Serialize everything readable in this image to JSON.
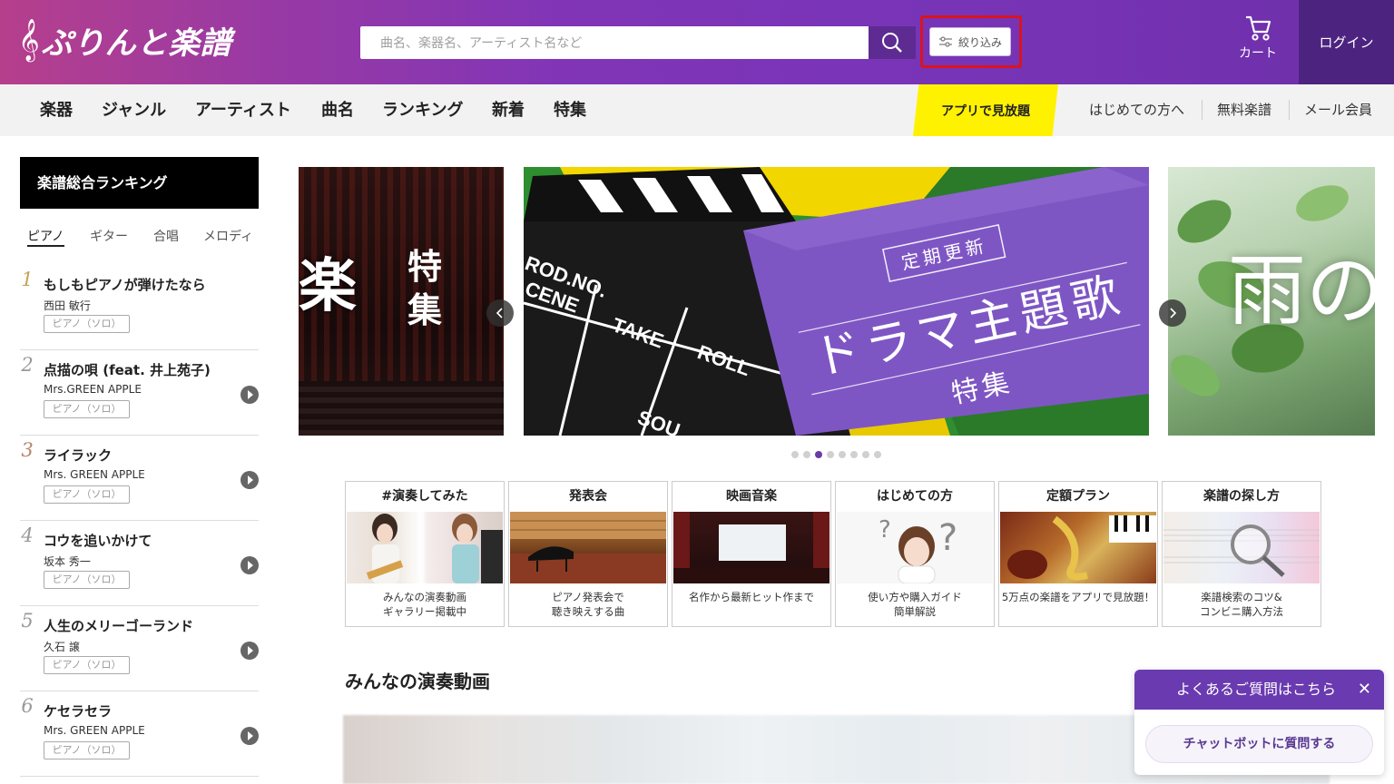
{
  "header": {
    "logo_text": "ぷりんと楽譜",
    "search_placeholder": "曲名、楽器名、アーティスト名など",
    "filter_label": "絞り込み",
    "cart_label": "カート",
    "login_label": "ログイン"
  },
  "nav": {
    "items": [
      "楽器",
      "ジャンル",
      "アーティスト",
      "曲名",
      "ランキング",
      "新着",
      "特集"
    ],
    "app_label": "アプリで見放題",
    "sub_items": [
      "はじめての方へ",
      "無料楽譜",
      "メール会員"
    ]
  },
  "ranking": {
    "title": "楽譜総合ランキング",
    "tabs": [
      "ピアノ",
      "ギター",
      "合唱",
      "メロディ"
    ],
    "active_tab": "ピアノ",
    "items": [
      {
        "rank": "1",
        "title": "もしもピアノが弾けたなら",
        "artist": "西田 敏行",
        "tag": "ピアノ（ソロ）"
      },
      {
        "rank": "2",
        "title": "点描の唄 (feat. 井上苑子)",
        "artist": "Mrs.GREEN APPLE",
        "tag": "ピアノ（ソロ）"
      },
      {
        "rank": "3",
        "title": "ライラック",
        "artist": "Mrs. GREEN APPLE",
        "tag": "ピアノ（ソロ）"
      },
      {
        "rank": "4",
        "title": "コウを追いかけて",
        "artist": "坂本 秀一",
        "tag": "ピアノ（ソロ）"
      },
      {
        "rank": "5",
        "title": "人生のメリーゴーランド",
        "artist": "久石 譲",
        "tag": "ピアノ（ソロ）"
      },
      {
        "rank": "6",
        "title": "ケセラセラ",
        "artist": "Mrs. GREEN APPLE",
        "tag": "ピアノ（ソロ）"
      }
    ]
  },
  "carousel": {
    "left_text_big": "楽",
    "left_text_small": "特集",
    "main": {
      "badge": "定期更新",
      "title": "ドラマ主題歌",
      "subtitle": "特集",
      "clapper_words": [
        "ROD.NO.",
        "CENE",
        "TAKE",
        "ROLL",
        "SOU"
      ]
    },
    "right_text": "雨の",
    "dot_count": 8,
    "active_dot": 3
  },
  "cards": [
    {
      "title": "#演奏してみた",
      "desc1": "みんなの演奏動画",
      "desc2": "ギャラリー掲載中"
    },
    {
      "title": "発表会",
      "desc1": "ピアノ発表会で",
      "desc2": "聴き映えする曲"
    },
    {
      "title": "映画音楽",
      "desc1": "名作から最新ヒット作まで",
      "desc2": ""
    },
    {
      "title": "はじめての方",
      "desc1": "使い方や購入ガイド",
      "desc2": "簡単解説"
    },
    {
      "title": "定額プラン",
      "desc1": "5万点の楽譜をアプリで見放題！",
      "desc2": ""
    },
    {
      "title": "楽譜の探し方",
      "desc1": "楽譜検索のコツ&",
      "desc2": "コンビニ購入方法"
    }
  ],
  "section": {
    "title": "みんなの演奏動画"
  },
  "chat": {
    "header": "よくあるご質問はこちら",
    "close": "✕",
    "button": "チャットボットに質問する"
  },
  "colors": {
    "header_gradient_start": "#b63f8c",
    "header_gradient_end": "#6d2fa8",
    "login_bg": "#4c2480",
    "app_button_bg": "#fff200",
    "filter_highlight": "#d9141f",
    "chat_header_bg": "#6a3ab0"
  }
}
